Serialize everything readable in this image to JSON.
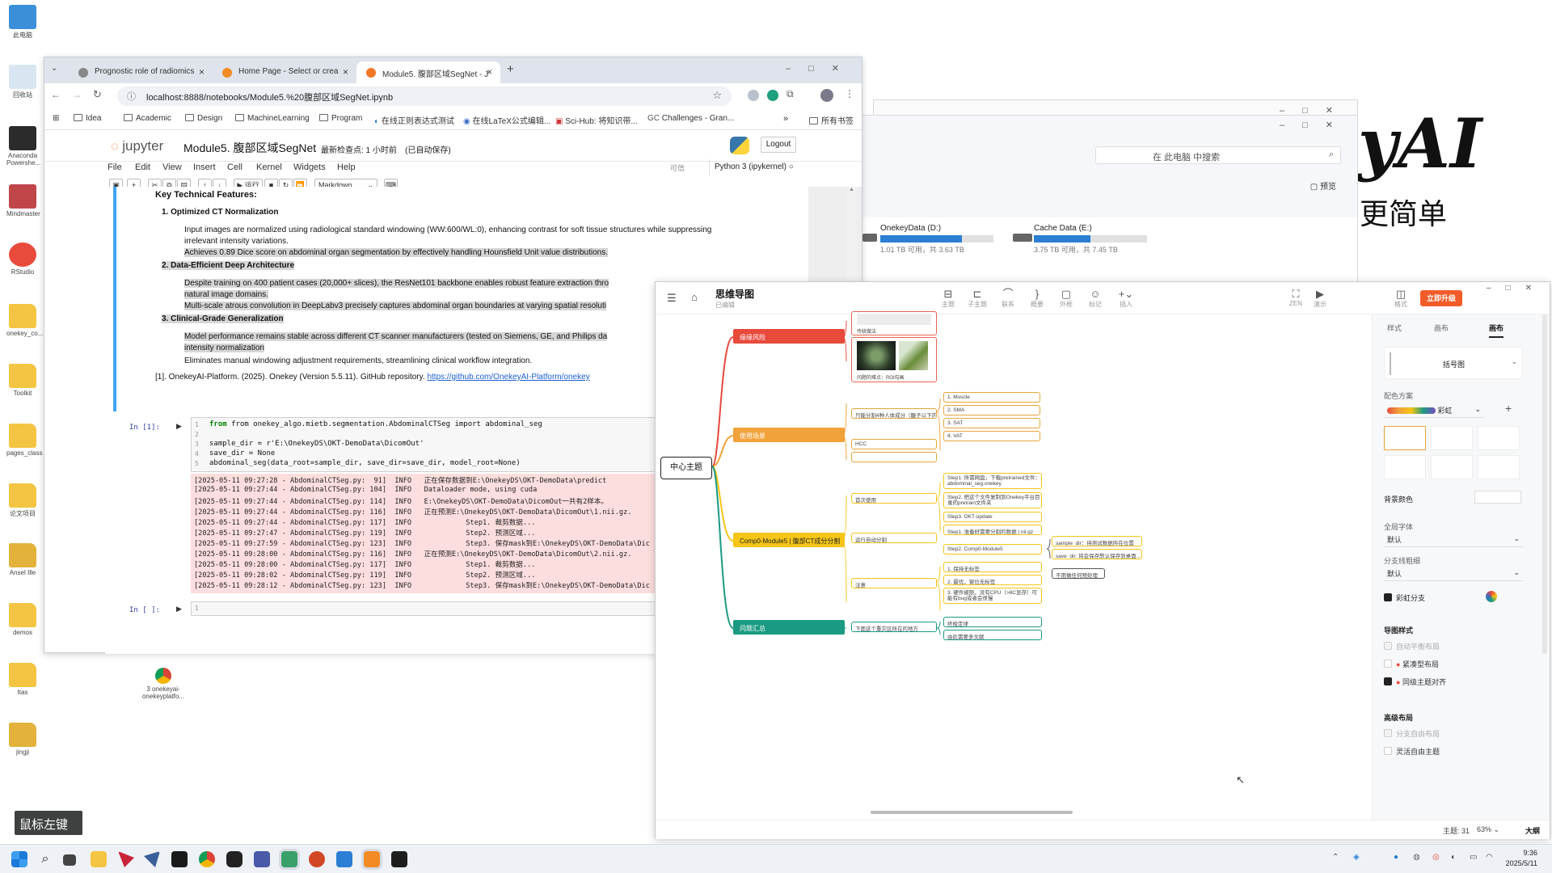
{
  "desktop": {
    "icons": [
      "此电脑",
      "回收站",
      "Anaconda Powershe...",
      "Mindmaster",
      "RStudio",
      "onekey_co...",
      "Toolkit",
      "pages_class",
      "论文项目",
      "Ansel Ille",
      "demos",
      "Itas",
      "jingji"
    ],
    "file_icon_label": "3 onekeyai-onekeyplatfo..."
  },
  "background_logo": {
    "text": "yAI",
    "subtext": "更简单"
  },
  "explorer": {
    "search_placeholder": "在 此电脑 中搜索",
    "preview_label": "预览",
    "drives": [
      {
        "name": "OnekeyData (D:)",
        "space": "1.01 TB 可用，共 3.63 TB",
        "used_fraction": 0.72
      },
      {
        "name": "Cache Data (E:)",
        "space": "3.75 TB 可用，共 7.45 TB",
        "used_fraction": 0.5
      }
    ]
  },
  "browser": {
    "tabs": [
      {
        "title": "Prognostic role of radiomics"
      },
      {
        "title": "Home Page - Select or crea"
      },
      {
        "title": "Module5. 腹部区域SegNet - J"
      }
    ],
    "url": "localhost:8888/notebooks/Module5.%20腹部区域SegNet.ipynb",
    "bookmarks": [
      "Idea",
      "Academic",
      "Design",
      "MachineLearning",
      "Program",
      "在线正则表达式测试",
      "在线LaTeX公式编辑...",
      "Sci-Hub: 将知识带...",
      "Challenges - Gran..."
    ],
    "all_bookmarks": "所有书签"
  },
  "jupyter": {
    "logo": "jupyter",
    "notebook_title": "Module5. 腹部区域SegNet",
    "checkpoint": "最新检查点: 1 小时前",
    "autosave": "(已自动保存)",
    "logout": "Logout",
    "menu": [
      "File",
      "Edit",
      "View",
      "Insert",
      "Cell",
      "Kernel",
      "Widgets",
      "Help"
    ],
    "trusted": "可信",
    "kernel": "Python 3 (ipykernel)",
    "run_label": "运行",
    "cell_type": "Markdown",
    "markdown": {
      "heading": "Key Technical Features:",
      "s1": "1. Optimized CT Normalization",
      "s1_b1a": "Input images are normalized using radiological standard windowing (WW:600/WL:0), enhancing contrast for soft tissue structures while suppressing",
      "s1_b1b": "irrelevant intensity variations.",
      "s1_b2": "Achieves 0.89 Dice score on abdominal organ segmentation by effectively handling Hounsfield Unit value distributions.",
      "s2": "2. Data-Efficient Deep Architecture",
      "s2_b1a": "Despite training on 400 patient cases (20,000+ slices), the ResNet101 backbone enables robust feature extraction thro",
      "s2_b1b": "natural image domains.",
      "s2_b2": "Multi-scale atrous convolution in DeepLabv3 precisely captures abdominal organ boundaries at varying spatial resoluti",
      "s3": "3. Clinical-Grade Generalization",
      "s3_b1a": "Model performance remains stable across different CT scanner manufacturers (tested on Siemens, GE, and Philips da",
      "s3_b1b": "intensity normalization",
      "s3_b2": "Eliminates manual windowing adjustment requirements, streamlining clinical workflow integration.",
      "ref": "[1]. OnekeyAI-Platform. (2025). Onekey (Version 5.5.11). GitHub repository.",
      "ref_link": "https://github.com/OnekeyAI-Platform/onekey"
    },
    "code_prompt": "In [1]:",
    "empty_prompt": "In [ ]:",
    "code_lines": [
      "from onekey_algo.mietb.segmentation.AbdominalCTSeg import abdominal_seg",
      "",
      "sample_dir = r'E:\\OnekeyDS\\OKT-DemoData\\DicomOut'",
      "save_dir = None",
      "abdominal_seg(data_root=sample_dir, save_dir=save_dir, model_root=None)"
    ],
    "output_lines": [
      "[2025-05-11 09:27:28 - AbdominalCTSeg.py:  91]  INFO   正在保存数据到E:\\OnekeyDS\\OKT-DemoData\\predict",
      "[2025-05-11 09:27:44 - AbdominalCTSeg.py: 104]  INFO   Dataloader mode, using cuda",
      "[2025-05-11 09:27:44 - AbdominalCTSeg.py: 114]  INFO   E:\\OnekeyDS\\OKT-DemoData\\DicomOut一共有2样本。",
      "[2025-05-11 09:27:44 - AbdominalCTSeg.py: 116]  INFO   正在预测E:\\OnekeyDS\\OKT-DemoData\\DicomOut\\1.nii.gz.",
      "[2025-05-11 09:27:44 - AbdominalCTSeg.py: 117]  INFO             Step1. 裁剪数据...",
      "[2025-05-11 09:27:47 - AbdominalCTSeg.py: 119]  INFO             Step2. 预测区域...",
      "[2025-05-11 09:27:59 - AbdominalCTSeg.py: 123]  INFO             Step3. 保存mask到E:\\OnekeyDS\\OKT-DemoData\\Dic",
      "[2025-05-11 09:28:00 - AbdominalCTSeg.py: 116]  INFO   正在预测E:\\OnekeyDS\\OKT-DemoData\\DicomOut\\2.nii.gz.",
      "[2025-05-11 09:28:00 - AbdominalCTSeg.py: 117]  INFO             Step1. 裁剪数据...",
      "[2025-05-11 09:28:02 - AbdominalCTSeg.py: 119]  INFO             Step2. 预测区域...",
      "[2025-05-11 09:28:12 - AbdominalCTSeg.py: 123]  INFO             Step3. 保存mask到E:\\OnekeyDS\\OKT-DemoData\\Dic"
    ]
  },
  "mindmap": {
    "app_title": "思维导图",
    "subtitle": "已编辑",
    "tools": [
      "主题",
      "子主题",
      "联系",
      "概要",
      "外框",
      "标记",
      "插入"
    ],
    "right_tools": [
      "ZEN",
      "演示"
    ],
    "panel_toggle": "格式",
    "upgrade": "立即升级",
    "center_topic": "中心主题",
    "branches": [
      {
        "label": "缘缘风险"
      },
      {
        "label": "使用场景"
      },
      {
        "label": "Comp0-Module5 | 腹部CT成分分割"
      },
      {
        "label": "问题汇总"
      }
    ],
    "image_caption": "问题的难点：ROI勾画",
    "top_caption": "传统做法",
    "scene_mid": "只能分割4种人体成分（腹子以下的以上",
    "scene_leaves": [
      "1. Muscle",
      "2. SMA",
      "3. SAT",
      "4. VAT"
    ],
    "hcc_leaf": "HCC",
    "comp_subs": [
      "首次使用",
      "运行自动分割",
      "注意"
    ],
    "comp_leaves": [
      "Step1. 所需网盘，下载pretrained文件：abdominal_seg.onekey",
      "Step2. 把这个文件复制到Onekey平台目录的pretrain文件夹",
      "Step3. OKT-update",
      "Step1. 准备好需要分割的数据 | nii.gz",
      "Step2. Comp0-Module5",
      "1. 保持无标签",
      "2. 最优，窗位无标签",
      "3. 硬件被限，没有CPU（>8C显存）可能有bug或者会很慢"
    ],
    "comp_params": [
      "sample_dir：待测试数据所在位置",
      "save_dir: 将会保存默认保存到桌面..."
    ],
    "note_label": "不用做任何预处理",
    "issue_mid": "下面这个重灾区所在的地方",
    "issue_leaves": [
      "终极定律",
      "由此需要多文献"
    ],
    "panel_tabs": [
      "样式",
      "画布",
      "画布"
    ],
    "structure": "括号图",
    "color_scheme_label": "配色方案",
    "color_scheme_value": "彩虹",
    "bg_color_label": "背景颜色",
    "font_label": "全局字体",
    "font_value": "默认",
    "branch_label": "分支线粗细",
    "branch_value": "默认",
    "rainbow_branch": "彩虹分支",
    "map_style_label": "导图样式",
    "map_style_opts": [
      {
        "label": "自动平衡布局",
        "checked": false
      },
      {
        "label": "紧凑型布局",
        "checked": false
      },
      {
        "label": "同级主题对齐",
        "checked": true
      }
    ],
    "advanced_label": "高级布局",
    "advanced_opts": [
      "分支自由布局",
      "灵活自由主题"
    ],
    "topic_count": "主题: 31",
    "zoom": "63%",
    "size_label": "大纲"
  },
  "mouse_indicator": "鼠标左键",
  "taskbar": {
    "time": "9:36",
    "date": "2025/5/11"
  }
}
